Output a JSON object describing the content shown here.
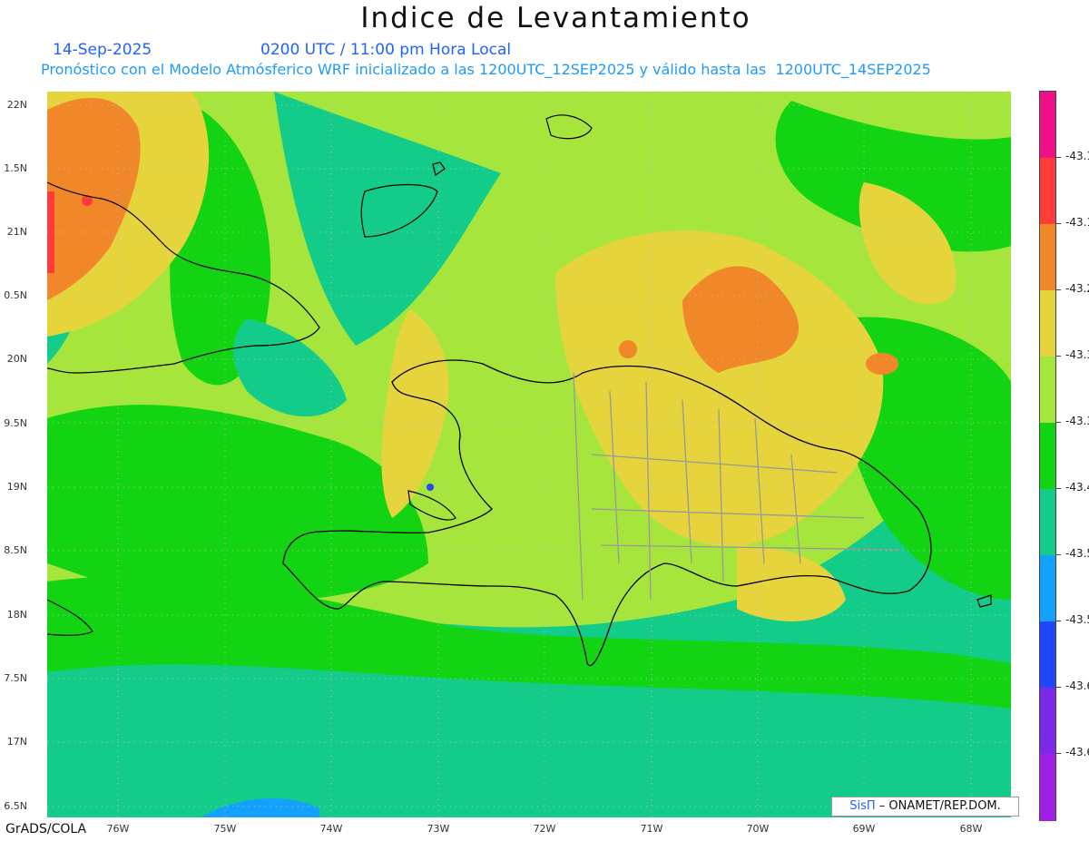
{
  "title": "Indice de Levantamiento",
  "date_text": "14-Sep-2025",
  "time_text": "0200 UTC / 11:00 pm Hora Local",
  "forecast_text": "Pronóstico con el Modelo Atmósferico WRF inicializado a las 1200UTC_12SEP2025 y válido hasta las  1200UTC_14SEP2025",
  "lat_labels": [
    "22N",
    "1.5N",
    "21N",
    "0.5N",
    "20N",
    "9.5N",
    "19N",
    "8.5N",
    "18N",
    "7.5N",
    "17N",
    "6.5N"
  ],
  "lon_labels": [
    "76W",
    "75W",
    "74W",
    "73W",
    "72W",
    "71W",
    "70W",
    "69W",
    "68W"
  ],
  "credit": "GrADS/COLA",
  "stamp_sis": "SisΠ",
  "stamp_rest": " – ONAMET/REP.DOM.",
  "colorbar": {
    "labels": [
      "-43.1",
      "-43.1",
      "-43.2",
      "-43.3",
      "-43.3",
      "-43.4",
      "-43.5",
      "-43.5",
      "-43.6",
      "-43.6"
    ],
    "colors": [
      "#ee1188",
      "#ff3c3c",
      "#f0882a",
      "#e6d43c",
      "#a6e63c",
      "#12d412",
      "#14cc8a",
      "#14a0ff",
      "#2046ff",
      "#7a2ae6",
      "#a020e6"
    ]
  }
}
